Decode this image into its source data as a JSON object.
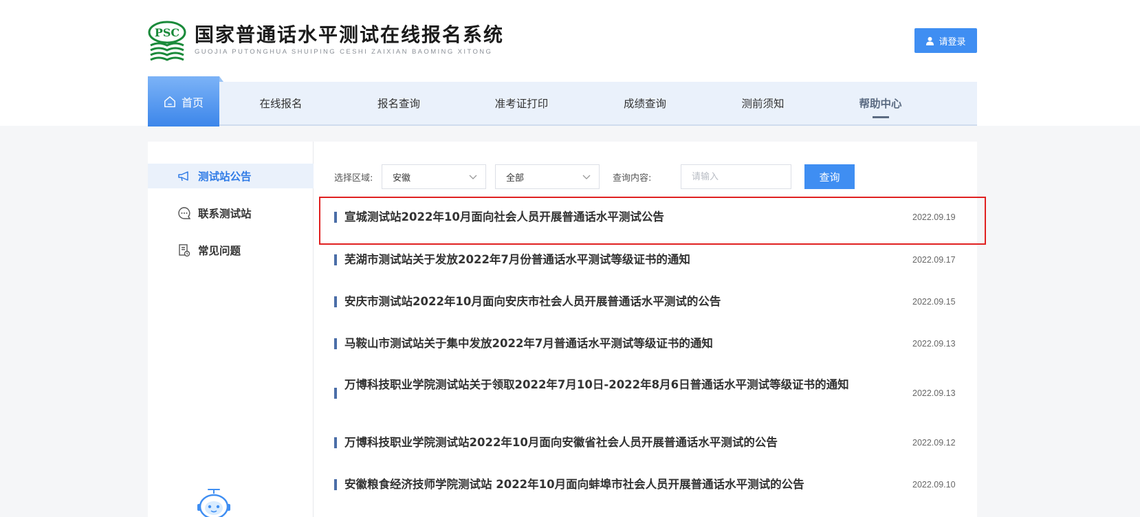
{
  "header": {
    "logo_badge": "PSC",
    "title": "国家普通话水平测试在线报名系统",
    "subtitle": "GUOJIA PUTONGHUA SHUIPING CESHI ZAIXIAN BAOMING XITONG",
    "login_label": "请登录",
    "login_icon": "user-icon"
  },
  "nav": {
    "home_label": "首页",
    "home_icon": "home-icon",
    "items": [
      {
        "label": "在线报名"
      },
      {
        "label": "报名查询"
      },
      {
        "label": "准考证打印"
      },
      {
        "label": "成绩查询"
      },
      {
        "label": "测前须知"
      },
      {
        "label": "帮助中心"
      }
    ],
    "active": "帮助中心"
  },
  "sidebar": {
    "items": [
      {
        "label": "测试站公告",
        "icon": "megaphone-icon",
        "active": true
      },
      {
        "label": "联系测试站",
        "icon": "chat-bubble-icon",
        "active": false
      },
      {
        "label": "常见问题",
        "icon": "faq-document-icon",
        "active": false
      }
    ],
    "assistant_icon": "robot-assistant-icon"
  },
  "filters": {
    "region_label": "选择区域:",
    "region_value": "安徽",
    "sub_region_value": "全部",
    "query_label": "查询内容:",
    "query_placeholder": "请输入",
    "search_label": "查询"
  },
  "notices": [
    {
      "title": "宣城测试站2022年10月面向社会人员开展普通话水平测试公告",
      "date": "2022.09.19",
      "highlighted": true
    },
    {
      "title": "芜湖市测试站关于发放2022年7月份普通话水平测试等级证书的通知",
      "date": "2022.09.17"
    },
    {
      "title": "安庆市测试站2022年10月面向安庆市社会人员开展普通话水平测试的公告",
      "date": "2022.09.15"
    },
    {
      "title": "马鞍山市测试站关于集中发放2022年7月普通话水平测试等级证书的通知",
      "date": "2022.09.13"
    },
    {
      "title": "万博科技职业学院测试站关于领取2022年7月10日-2022年8月6日普通话水平测试等级证书的通知",
      "date": "2022.09.13"
    },
    {
      "title": "万博科技职业学院测试站2022年10月面向安徽省社会人员开展普通话水平测试的公告",
      "date": "2022.09.12"
    },
    {
      "title": "安徽粮食经济技师学院测试站 2022年10月面向蚌埠市社会人员开展普通话水平测试的公告",
      "date": "2022.09.10"
    }
  ],
  "colors": {
    "accent": "#3f8ef2",
    "nav_bg": "#eaf1fb",
    "highlight_border": "#e02020"
  }
}
